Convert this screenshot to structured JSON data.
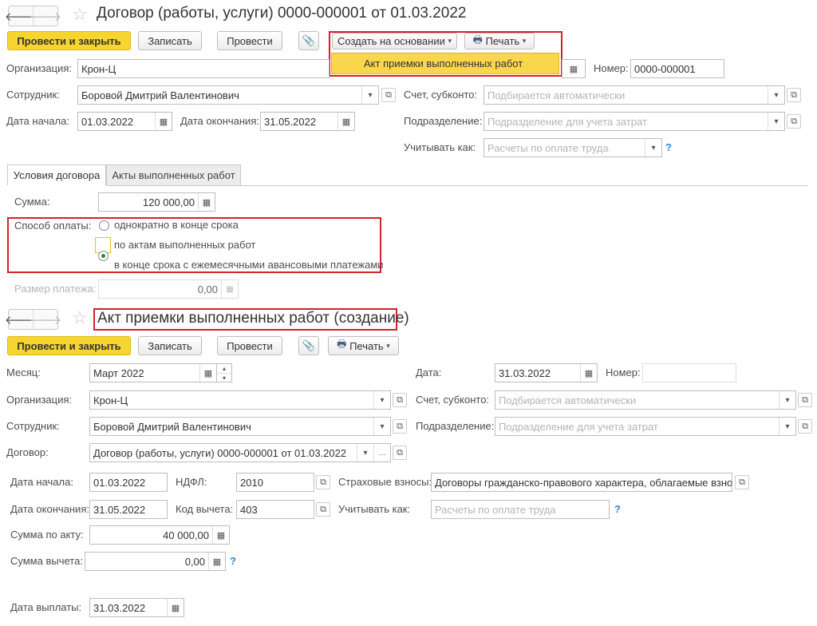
{
  "doc1": {
    "title": "Договор (работы, услуги) 0000-000001 от 01.03.2022",
    "nav": {
      "back": "🡐",
      "forward": "🡒",
      "star": "☆"
    },
    "toolbar": {
      "post_close": "Провести и закрыть",
      "save": "Записать",
      "post": "Провести",
      "attach_icon": "📎",
      "create_based": "Создать на основании",
      "print": "Печать",
      "dropdown_item": "Акт приемки выполненных работ"
    },
    "fields": {
      "org_label": "Организация:",
      "org_value": "Крон-Ц",
      "number_label": "Номер:",
      "number_value": "0000-000001",
      "employee_label": "Сотрудник:",
      "employee_value": "Боровой Дмитрий Валентинович",
      "account_label": "Счет, субконто:",
      "account_placeholder": "Подбирается автоматически",
      "start_label": "Дата начала:",
      "start_value": "01.03.2022",
      "end_label": "Дата окончания:",
      "end_value": "31.05.2022",
      "dept_label": "Подразделение:",
      "dept_placeholder": "Подразделение для учета затрат",
      "consider_label": "Учитывать как:",
      "consider_placeholder": "Расчеты по оплате труда",
      "help": "?"
    },
    "tabs": [
      "Условия договора",
      "Акты выполненных работ"
    ],
    "terms": {
      "sum_label": "Сумма:",
      "sum_value": "120 000,00",
      "pay_label": "Способ оплаты:",
      "options": [
        "однократно в конце срока",
        "по актам выполненных работ",
        "в конце срока с ежемесячными авансовыми платежами"
      ],
      "selected_option": 1,
      "payment_size_label": "Размер платежа:",
      "payment_size_value": "0,00"
    }
  },
  "doc2": {
    "title": "Акт приемки выполненных работ (создание)",
    "toolbar": {
      "post_close": "Провести и закрыть",
      "save": "Записать",
      "post": "Провести",
      "print": "Печать"
    },
    "fields": {
      "month_label": "Месяц:",
      "month_value": "Март 2022",
      "date_label": "Дата:",
      "date_value": "31.03.2022",
      "number_label": "Номер:",
      "number_value": "",
      "org_label": "Организация:",
      "org_value": "Крон-Ц",
      "account_label": "Счет, субконто:",
      "account_placeholder": "Подбирается автоматически",
      "employee_label": "Сотрудник:",
      "employee_value": "Боровой Дмитрий Валентинович",
      "dept_label": "Подразделение:",
      "dept_placeholder": "Подразделение для учета затрат",
      "contract_label": "Договор:",
      "contract_value": "Договор (работы, услуги) 0000-000001 от 01.03.2022",
      "start_label": "Дата начала:",
      "start_value": "01.03.2022",
      "ndfl_label": "НДФЛ:",
      "ndfl_value": "2010",
      "insurance_label": "Страховые взносы:",
      "insurance_value": "Договоры гражданско-правового характера, облагаемые взносами",
      "end_label": "Дата окончания:",
      "end_value": "31.05.2022",
      "deduction_code_label": "Код вычета:",
      "deduction_code_value": "403",
      "consider_label": "Учитывать как:",
      "consider_placeholder": "Расчеты по оплате труда",
      "act_sum_label": "Сумма по акту:",
      "act_sum_value": "40 000,00",
      "deduction_sum_label": "Сумма вычета:",
      "deduction_sum_value": "0,00",
      "pay_date_label": "Дата выплаты:",
      "pay_date_value": "31.03.2022",
      "help": "?"
    }
  },
  "colors": {
    "primary_button": "#f7d530",
    "highlight_border": "#d6202a",
    "help": "#2f86c8"
  }
}
